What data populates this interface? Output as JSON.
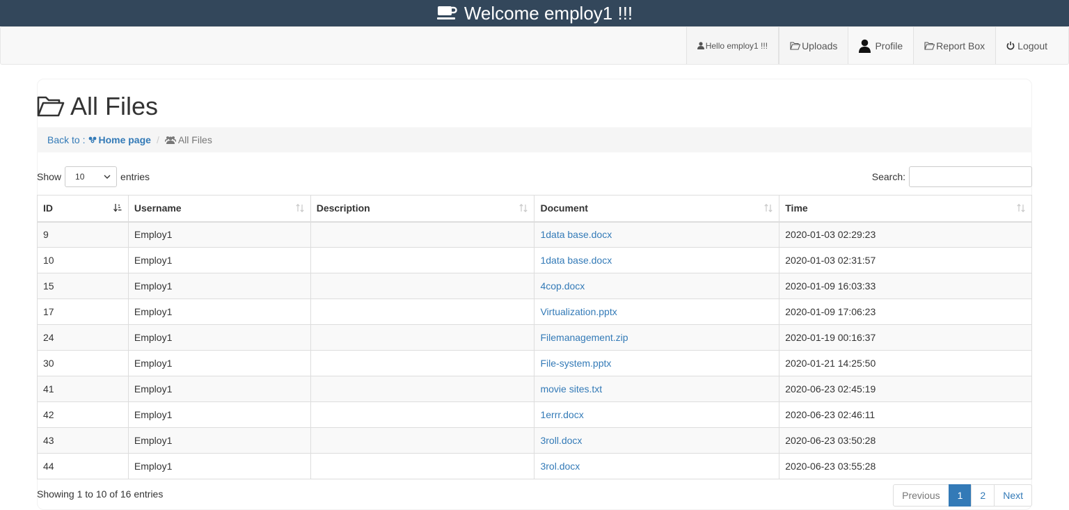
{
  "header": {
    "title": "Welcome employ1 !!!",
    "icon": "coffee-cup-icon"
  },
  "navbar": {
    "items": [
      {
        "label": "Hello employ1 !!!",
        "icon": "user-icon"
      },
      {
        "label": "Uploads",
        "icon": "folder-open-icon"
      },
      {
        "label": "Profile",
        "icon": "user-silhouette-icon"
      },
      {
        "label": "Report Box",
        "icon": "folder-open-icon"
      },
      {
        "label": "Logout",
        "icon": "power-icon"
      }
    ]
  },
  "page": {
    "title": "All Files",
    "breadcrumb": {
      "prefix": "Back to :",
      "home": "Home page",
      "current": "All Files"
    }
  },
  "table_controls": {
    "show_label": "Show",
    "entries_value": "10",
    "entries_label": "entries",
    "search_label": "Search:",
    "search_value": ""
  },
  "table": {
    "columns": [
      "ID",
      "Username",
      "Description",
      "Document",
      "Time"
    ],
    "sorted_column": "ID",
    "rows": [
      {
        "id": "9",
        "username": "Employ1",
        "description": "",
        "document": "1data base.docx",
        "time": "2020-01-03 02:29:23"
      },
      {
        "id": "10",
        "username": "Employ1",
        "description": "",
        "document": "1data base.docx",
        "time": "2020-01-03 02:31:57"
      },
      {
        "id": "15",
        "username": "Employ1",
        "description": "",
        "document": "4cop.docx",
        "time": "2020-01-09 16:03:33"
      },
      {
        "id": "17",
        "username": "Employ1",
        "description": "",
        "document": "Virtualization.pptx",
        "time": "2020-01-09 17:06:23"
      },
      {
        "id": "24",
        "username": "Employ1",
        "description": "",
        "document": "Filemanagement.zip",
        "time": "2020-01-19 00:16:37"
      },
      {
        "id": "30",
        "username": "Employ1",
        "description": "",
        "document": "File-system.pptx",
        "time": "2020-01-21 14:25:50"
      },
      {
        "id": "41",
        "username": "Employ1",
        "description": "",
        "document": "movie sites.txt",
        "time": "2020-06-23 02:45:19"
      },
      {
        "id": "42",
        "username": "Employ1",
        "description": "",
        "document": "1errr.docx",
        "time": "2020-06-23 02:46:11"
      },
      {
        "id": "43",
        "username": "Employ1",
        "description": "",
        "document": "3roll.docx",
        "time": "2020-06-23 03:50:28"
      },
      {
        "id": "44",
        "username": "Employ1",
        "description": "",
        "document": "3rol.docx",
        "time": "2020-06-23 03:55:28"
      }
    ]
  },
  "footer": {
    "info": "Showing 1 to 10 of 16 entries",
    "pagination": {
      "previous": "Previous",
      "pages": [
        "1",
        "2"
      ],
      "active_page": "1",
      "next": "Next"
    }
  },
  "colors": {
    "header_bg": "#33475b",
    "link": "#337ab7",
    "accent": "#337ab7"
  }
}
